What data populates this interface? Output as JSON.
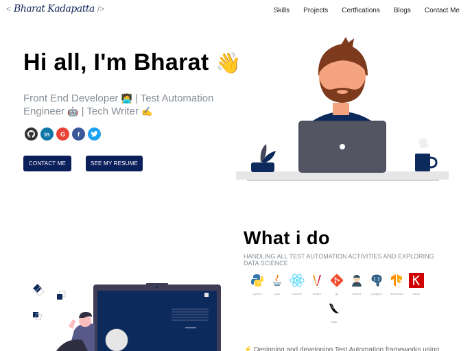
{
  "header": {
    "logo_open": "<",
    "logo_signature": "Bharat Kadapatta",
    "logo_close": "/>",
    "nav": [
      "Skills",
      "Projects",
      "Certfications",
      "Blogs",
      "Contact Me"
    ]
  },
  "hero": {
    "greeting": "Hi all, I'm Bharat",
    "greeting_emoji": "👋",
    "subtitle_parts": [
      "Front End Developer ",
      "🧑‍💻",
      " | Test Automation Engineer ",
      "🤖",
      " | Tech Writer ",
      "✍️"
    ],
    "socials": [
      {
        "name": "github",
        "glyph": "◉",
        "color": "#333333"
      },
      {
        "name": "linkedin",
        "glyph": "in",
        "color": "#0e76a8"
      },
      {
        "name": "google",
        "glyph": "G",
        "color": "#ea4335"
      },
      {
        "name": "facebook",
        "glyph": "f",
        "color": "#3b5998"
      },
      {
        "name": "twitter",
        "glyph": "🐦",
        "color": "#1da1f2"
      }
    ],
    "buttons": {
      "contact": "CONTACT ME",
      "resume": "SEE MY RESUME"
    }
  },
  "what_i_do": {
    "title": "What i do",
    "subtitle": "HANDLING ALL TEST AUTOMATION ACTIVITIES AND EXPLORING DATA SCIENCE",
    "skills": [
      {
        "label": "python",
        "color": "#3776ab"
      },
      {
        "label": "java",
        "color": "#e76f00"
      },
      {
        "label": "reactJS",
        "color": "#61dafb"
      },
      {
        "label": "maven",
        "color": "#c71a36"
      },
      {
        "label": "git",
        "color": "#f05032"
      },
      {
        "label": "jenkins",
        "color": "#d24939"
      },
      {
        "label": "postgres",
        "color": "#336791"
      },
      {
        "label": "tensorflow",
        "color": "#ff8f00"
      },
      {
        "label": "keras",
        "color": "#d00000"
      },
      {
        "label": "flask",
        "color": "#000000"
      }
    ],
    "bullet": "⚡ Designing and developing Test Automation frameworks using"
  }
}
